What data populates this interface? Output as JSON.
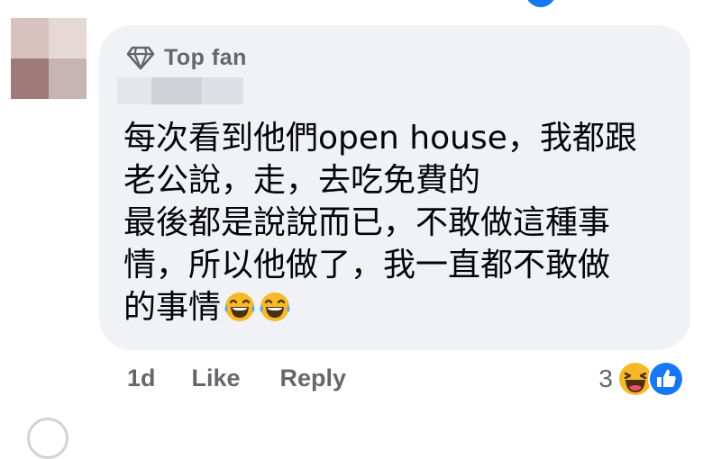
{
  "comment": {
    "badge_label": "Top fan",
    "badge_icon": "diamond-icon",
    "lines": [
      "每次看到他們open house，我都跟",
      "老公說，走，去吃免費的",
      "最後都是說說而已，不敢做這種事",
      "情，所以他做了，我一直都不敢做",
      "的事情"
    ],
    "trailing_emojis": [
      "laughing-crying-emoji",
      "laughing-crying-emoji"
    ]
  },
  "actions": {
    "timestamp": "1d",
    "like_label": "Like",
    "reply_label": "Reply"
  },
  "reactions": {
    "count": "3",
    "icons": [
      "haha-reaction-icon",
      "like-reaction-icon"
    ]
  },
  "colors": {
    "bubble_bg": "#f0f2f5",
    "secondary_text": "#65676b",
    "like_blue": "#1877f2"
  }
}
